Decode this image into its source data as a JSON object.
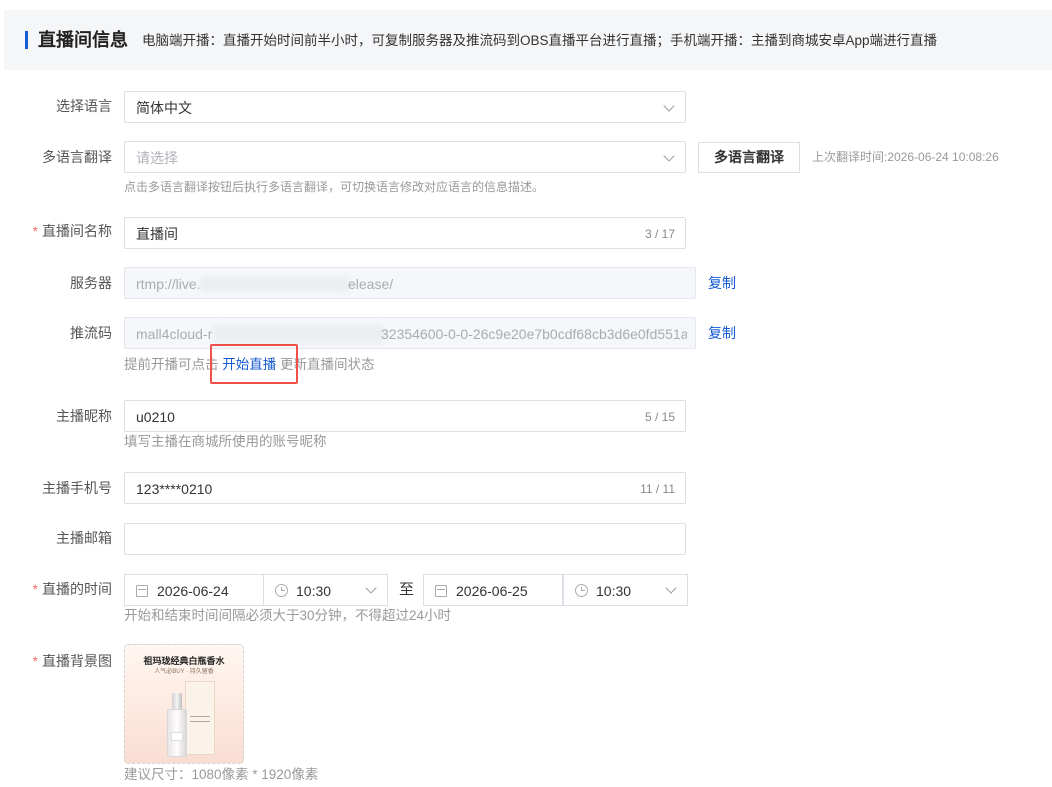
{
  "header": {
    "title": "直播间信息",
    "description": "电脑端开播：直播开始时间前半小时，可复制服务器及推流码到OBS直播平台进行直播；手机端开播：主播到商城安卓App端进行直播"
  },
  "form": {
    "language": {
      "label": "选择语言",
      "value": "简体中文"
    },
    "translate": {
      "label": "多语言翻译",
      "placeholder": "请选择",
      "button": "多语言翻译",
      "last_time": "上次翻译时间:2026-06-24 10:08:26",
      "hint": "点击多语言翻译按钮后执行多语言翻译，可切换语言修改对应语言的信息描述。"
    },
    "room_name": {
      "label": "直播间名称",
      "value": "直播间",
      "count": "3 / 17"
    },
    "server": {
      "label": "服务器",
      "value_start": "rtmp://live.",
      "value_end": "elease/",
      "copy": "复制"
    },
    "stream_key": {
      "label": "推流码",
      "value_start": "mall4cloud-r",
      "value_end": "32354600-0-0-26c9e20e7b0cdf68cb3d6e0fd551a",
      "copy": "复制",
      "hint_before": "提前开播可点击",
      "hint_link": "开始直播",
      "hint_after": "更新直播间状态"
    },
    "nickname": {
      "label": "主播昵称",
      "value": "u0210",
      "count": "5 / 15",
      "hint": "填写主播在商城所使用的账号昵称"
    },
    "phone": {
      "label": "主播手机号",
      "value": "123****0210",
      "count": "11 / 11"
    },
    "email": {
      "label": "主播邮箱",
      "value": ""
    },
    "live_time": {
      "label": "直播的时间",
      "start_date": "2026-06-24",
      "start_time": "10:30",
      "separator": "至",
      "end_date": "2026-06-25",
      "end_time": "10:30",
      "hint": "开始和结束时间间隔必须大于30分钟，不得超过24小时"
    },
    "background": {
      "label": "直播背景图",
      "image_title": "祖玛珑经典白瓶香水",
      "image_subtitle": "人气必BUY · 持久留香",
      "hint": "建议尺寸：1080像素 * 1920像素"
    }
  },
  "colors": {
    "primary": "#155bd4",
    "required": "#f56c6c",
    "highlight": "#f0504a"
  }
}
